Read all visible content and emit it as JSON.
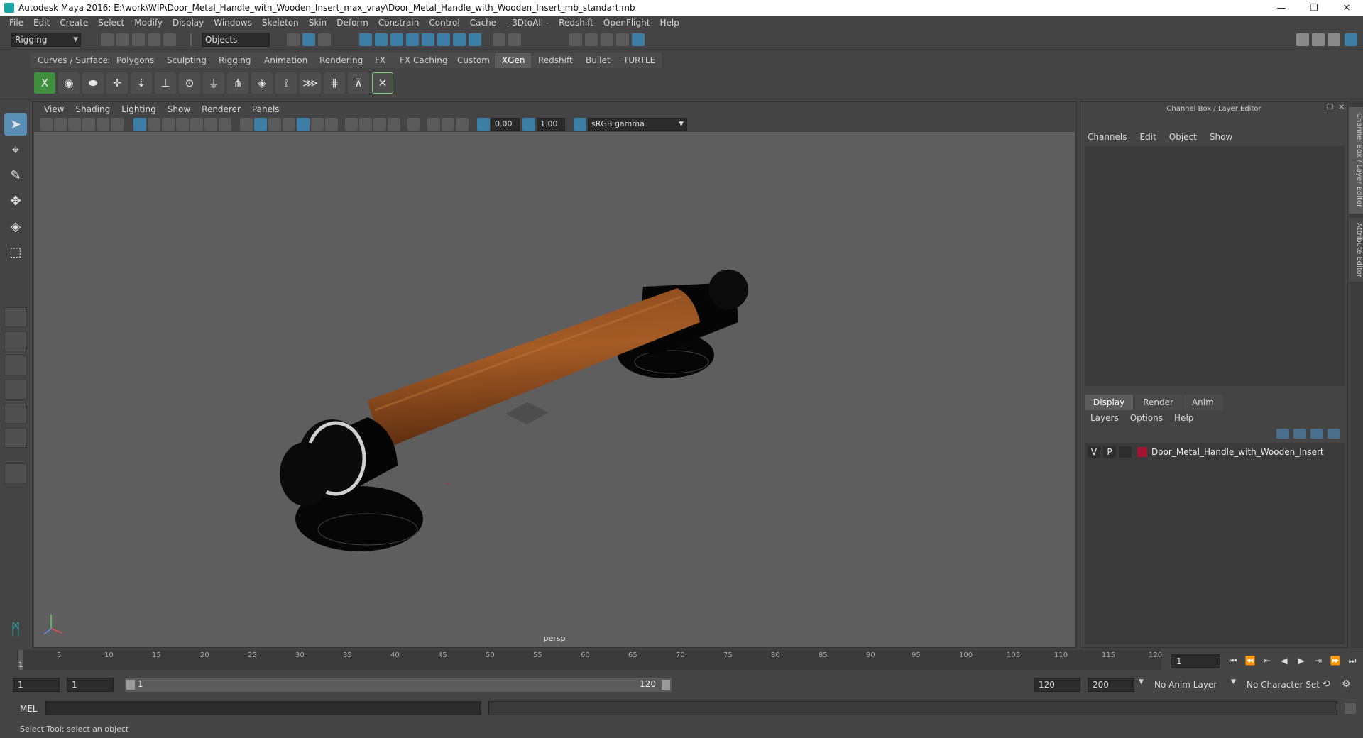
{
  "window": {
    "title": "Autodesk Maya 2016: E:\\work\\WIP\\Door_Metal_Handle_with_Wooden_Insert_max_vray\\Door_Metal_Handle_with_Wooden_Insert_mb_standart.mb",
    "minimize": "—",
    "maximize": "❐",
    "close": "✕"
  },
  "menubar": [
    "File",
    "Edit",
    "Create",
    "Select",
    "Modify",
    "Display",
    "Windows",
    "Skeleton",
    "Skin",
    "Deform",
    "Constrain",
    "Control",
    "Cache",
    "- 3DtoAll -",
    "Redshift",
    "OpenFlight",
    "Help"
  ],
  "statusline": {
    "mode": "Rigging",
    "selection_mask": "Objects"
  },
  "shelf_tabs": [
    "Curves / Surfaces",
    "Polygons",
    "Sculpting",
    "Rigging",
    "Animation",
    "Rendering",
    "FX",
    "FX Caching",
    "Custom",
    "XGen",
    "Redshift",
    "Bullet",
    "TURTLE"
  ],
  "shelf_active": "XGen",
  "viewport": {
    "menu": [
      "View",
      "Shading",
      "Lighting",
      "Show",
      "Renderer",
      "Panels"
    ],
    "exposure": "0.00",
    "gamma": "1.00",
    "color_space": "sRGB gamma",
    "camera_label": "persp"
  },
  "right_panel": {
    "title": "Channel Box / Layer Editor",
    "menu": [
      "Channels",
      "Edit",
      "Object",
      "Show"
    ],
    "layer_tabs": [
      "Display",
      "Render",
      "Anim"
    ],
    "layer_active": "Display",
    "layer_menu": [
      "Layers",
      "Options",
      "Help"
    ],
    "layers": [
      {
        "v": "V",
        "p": "P",
        "name": "Door_Metal_Handle_with_Wooden_Insert",
        "color": "#a2142f"
      }
    ],
    "side_tabs": [
      "Channel Box / Layer Editor",
      "Attribute Editor"
    ]
  },
  "timeslider": {
    "ticks": [
      "1",
      "5",
      "10",
      "15",
      "20",
      "25",
      "30",
      "35",
      "40",
      "45",
      "50",
      "55",
      "60",
      "65",
      "70",
      "75",
      "80",
      "85",
      "90",
      "95",
      "100",
      "105",
      "110",
      "115",
      "120"
    ],
    "current_frame": "1"
  },
  "rangeslider": {
    "start": "1",
    "playback_start": "1",
    "range_start": "1",
    "range_end": "120",
    "playback_end": "120",
    "end": "200",
    "anim_layer": "No Anim Layer",
    "character_set": "No Character Set"
  },
  "cmdline": {
    "label": "MEL"
  },
  "helpline": {
    "text": "Select Tool: select an object"
  }
}
